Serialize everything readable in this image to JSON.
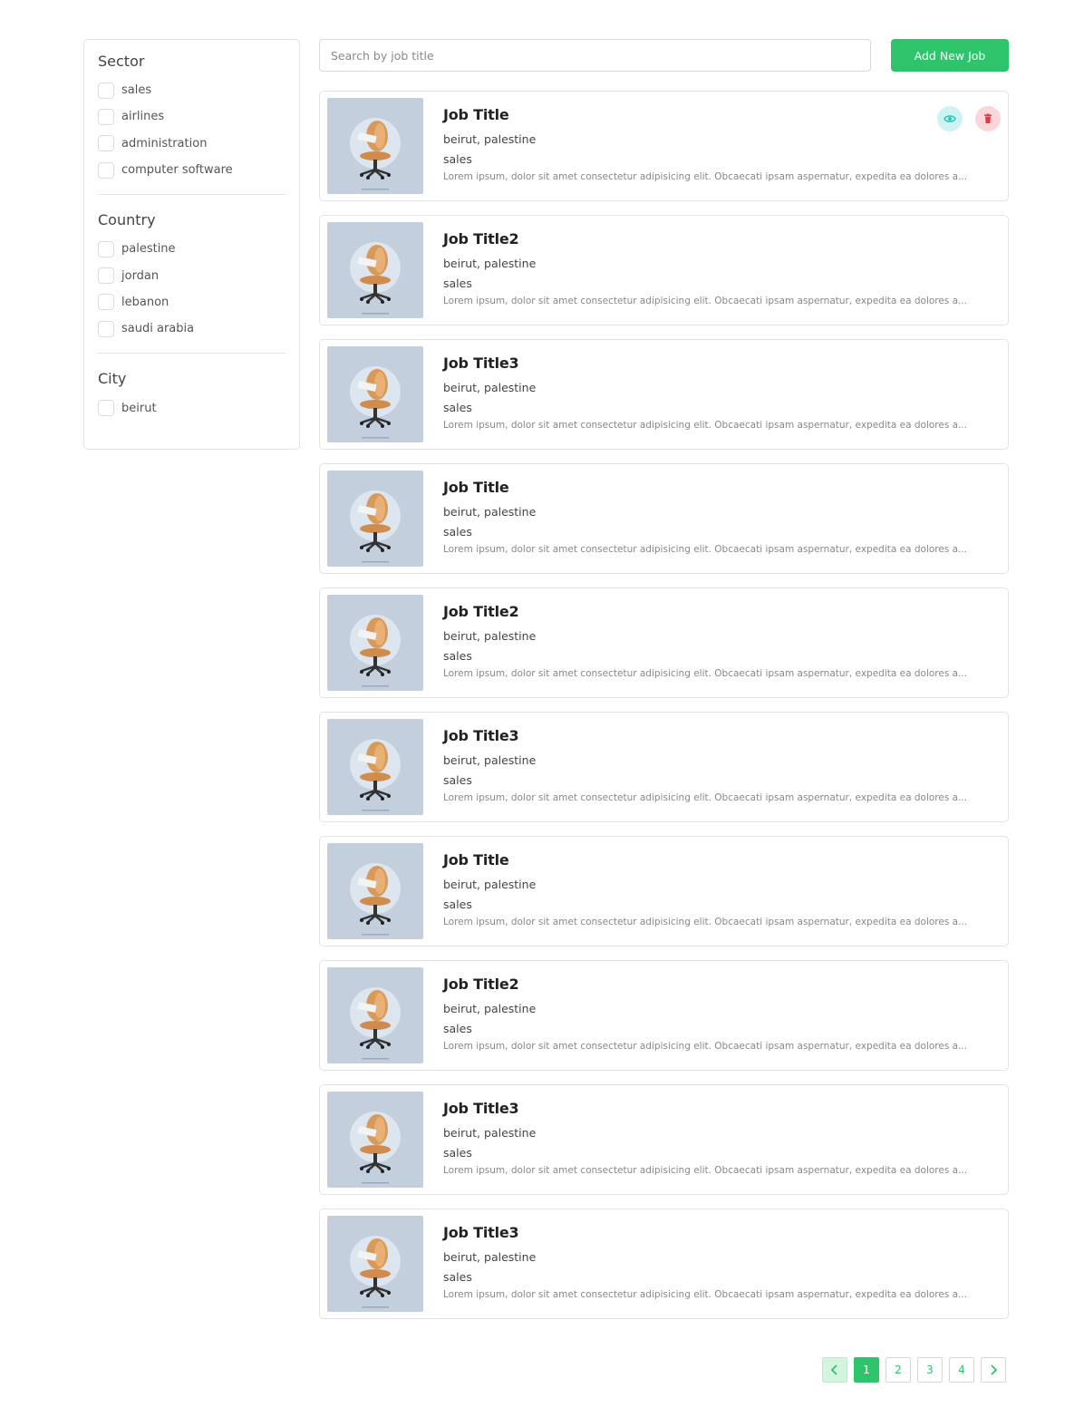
{
  "filters": {
    "groups": [
      {
        "title": "Sector",
        "options": [
          "sales",
          "airlines",
          "administration",
          "computer software"
        ]
      },
      {
        "title": "Country",
        "options": [
          "palestine",
          "jordan",
          "lebanon",
          "saudi arabia"
        ]
      },
      {
        "title": "City",
        "options": [
          "beirut"
        ]
      }
    ]
  },
  "search": {
    "placeholder": "Search by job title",
    "value": ""
  },
  "toolbar": {
    "add_label": "Add New Job",
    "accent": "#2ec46b"
  },
  "jobs": [
    {
      "title": "Job Title",
      "location": "beirut, palestine",
      "sector": "sales",
      "description": "Lorem ipsum, dolor sit amet consectetur adipisicing elit. Obcaecati ipsam aspernatur, expedita ea dolores a..."
    },
    {
      "title": "Job Title2",
      "location": "beirut, palestine",
      "sector": "sales",
      "description": "Lorem ipsum, dolor sit amet consectetur adipisicing elit. Obcaecati ipsam aspernatur, expedita ea dolores a..."
    },
    {
      "title": "Job Title3",
      "location": "beirut, palestine",
      "sector": "sales",
      "description": "Lorem ipsum, dolor sit amet consectetur adipisicing elit. Obcaecati ipsam aspernatur, expedita ea dolores a..."
    },
    {
      "title": "Job Title",
      "location": "beirut, palestine",
      "sector": "sales",
      "description": "Lorem ipsum, dolor sit amet consectetur adipisicing elit. Obcaecati ipsam aspernatur, expedita ea dolores a..."
    },
    {
      "title": "Job Title2",
      "location": "beirut, palestine",
      "sector": "sales",
      "description": "Lorem ipsum, dolor sit amet consectetur adipisicing elit. Obcaecati ipsam aspernatur, expedita ea dolores a..."
    },
    {
      "title": "Job Title3",
      "location": "beirut, palestine",
      "sector": "sales",
      "description": "Lorem ipsum, dolor sit amet consectetur adipisicing elit. Obcaecati ipsam aspernatur, expedita ea dolores a..."
    },
    {
      "title": "Job Title",
      "location": "beirut, palestine",
      "sector": "sales",
      "description": "Lorem ipsum, dolor sit amet consectetur adipisicing elit. Obcaecati ipsam aspernatur, expedita ea dolores a..."
    },
    {
      "title": "Job Title2",
      "location": "beirut, palestine",
      "sector": "sales",
      "description": "Lorem ipsum, dolor sit amet consectetur adipisicing elit. Obcaecati ipsam aspernatur, expedita ea dolores a..."
    },
    {
      "title": "Job Title3",
      "location": "beirut, palestine",
      "sector": "sales",
      "description": "Lorem ipsum, dolor sit amet consectetur adipisicing elit. Obcaecati ipsam aspernatur, expedita ea dolores a..."
    },
    {
      "title": "Job Title3",
      "location": "beirut, palestine",
      "sector": "sales",
      "description": "Lorem ipsum, dolor sit amet consectetur adipisicing elit. Obcaecati ipsam aspernatur, expedita ea dolores a..."
    }
  ],
  "card_actions": {
    "view_icon": "eye-icon",
    "delete_icon": "trash-icon",
    "view_color": "#2ec4b6",
    "delete_color": "#e03a48"
  },
  "pagination": {
    "pages": [
      "1",
      "2",
      "3",
      "4"
    ],
    "current": "1",
    "prev_icon": "chevron-left-icon",
    "next_icon": "chevron-right-icon"
  }
}
